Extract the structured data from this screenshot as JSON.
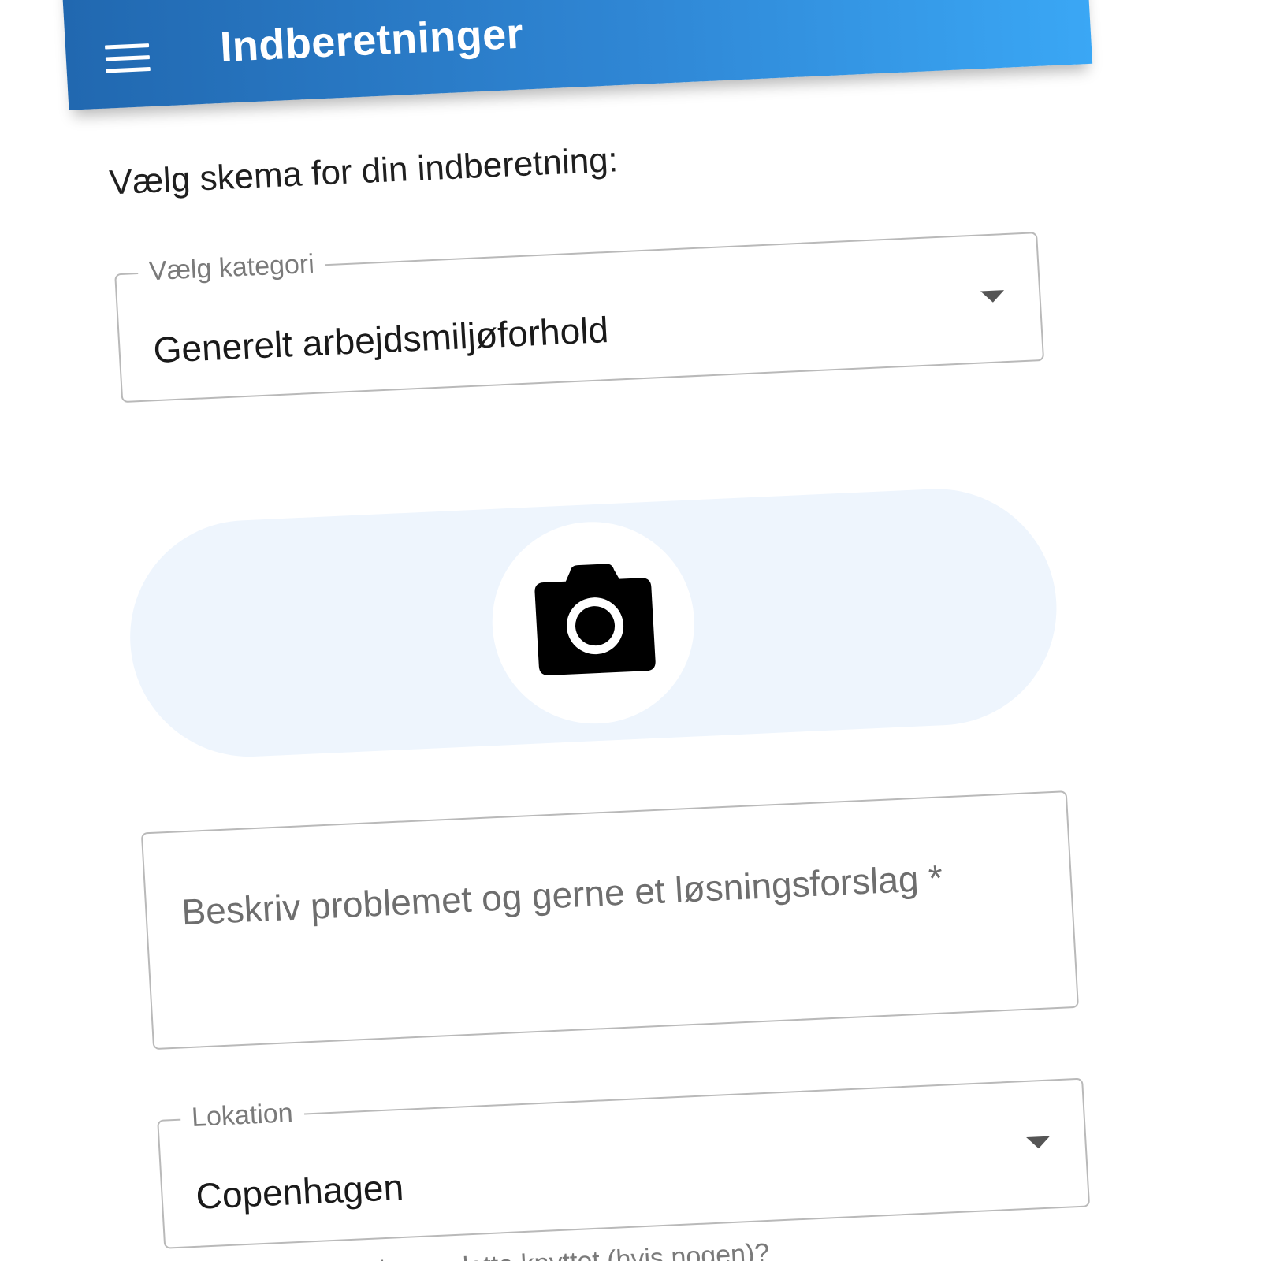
{
  "app_bar": {
    "title": "Indberetninger",
    "menu_icon": "menu-icon",
    "account_icon": "account-circle-icon",
    "gradient": [
      "#2168b0",
      "#3aa7f5"
    ]
  },
  "form": {
    "prompt": "Vælg skema for din indberetning:",
    "category": {
      "label": "Vælg kategori",
      "value": "Generelt arbejdsmiljøforhold"
    },
    "photo_upload": {
      "icon": "camera-icon",
      "background": "#eef5fd"
    },
    "description": {
      "placeholder": "Beskriv problemet og gerne et løsningsforslag *",
      "value": ""
    },
    "location": {
      "label": "Lokation",
      "value": "Copenhagen",
      "helper": "Til hvilken lokation er dette knyttet (hvis nogen)?"
    }
  }
}
